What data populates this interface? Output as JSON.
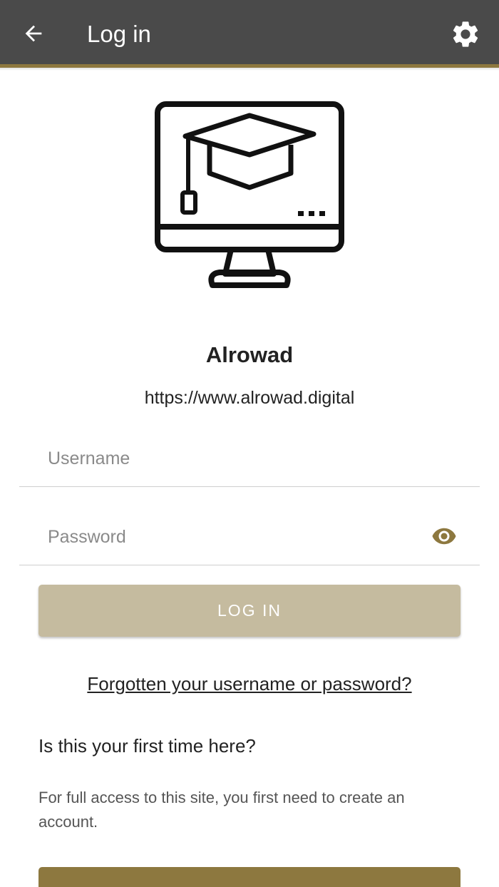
{
  "header": {
    "title": "Log in",
    "back_icon": "arrow-left-icon",
    "settings_icon": "gear-icon",
    "background_color": "#4a4a4a",
    "accent_color": "#8d783f"
  },
  "site": {
    "logo_icon": "monitor-graduation-cap-icon",
    "name": "Alrowad",
    "url": "https://www.alrowad.digital"
  },
  "form": {
    "username_placeholder": "Username",
    "username_value": "",
    "password_placeholder": "Password",
    "password_value": "",
    "show_password_icon": "eye-icon",
    "login_button_label": "LOG IN",
    "forgot_link": "Forgotten your username or password?"
  },
  "signup": {
    "heading": "Is this your first time here?",
    "description": "For full access to this site, you first need to create an account."
  },
  "colors": {
    "primary": "#8d783f",
    "login_button_disabled": "#c5bb9f",
    "eye_icon": "#8d783f"
  }
}
